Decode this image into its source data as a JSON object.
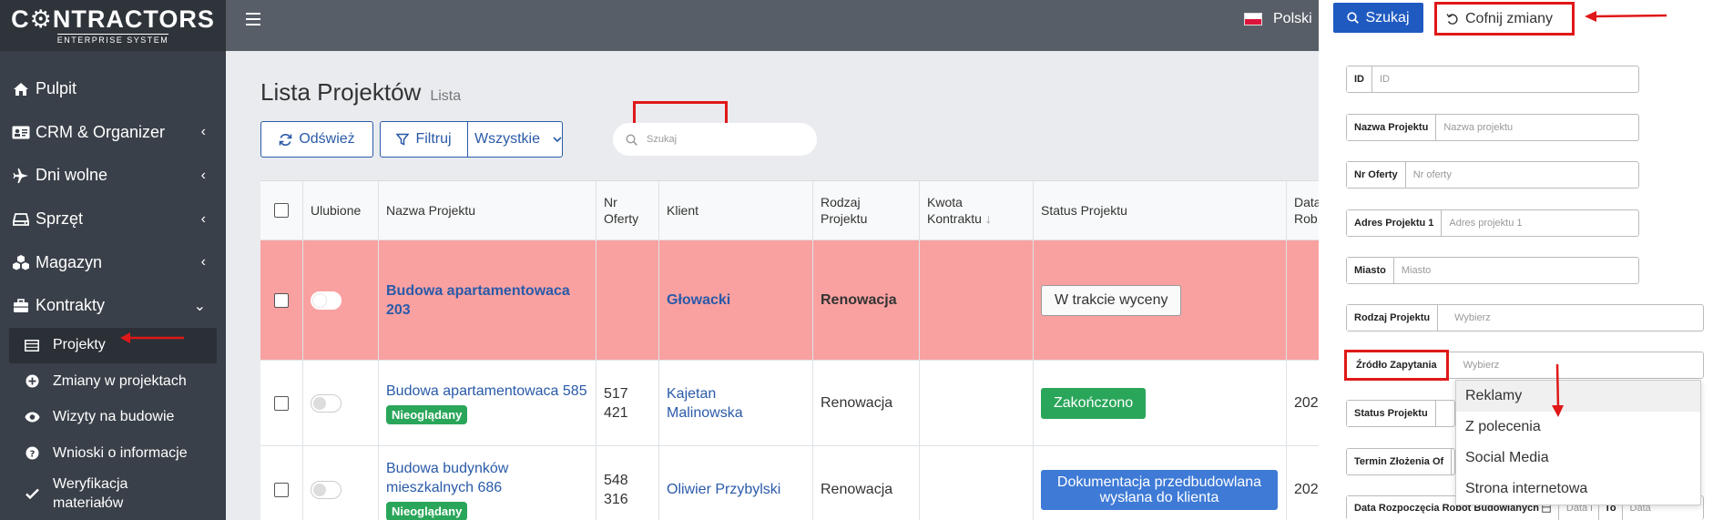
{
  "brand": {
    "name_pre": "C",
    "name_post": "NTRACTORS",
    "tagline": "ENTERPRISE SYSTEM"
  },
  "sidebar": {
    "items": [
      {
        "label": "Pulpit",
        "icon": "home-icon"
      },
      {
        "label": "CRM & Organizer",
        "icon": "id-card-icon"
      },
      {
        "label": "Dni wolne",
        "icon": "plane-icon"
      },
      {
        "label": "Sprzęt",
        "icon": "hdd-icon"
      },
      {
        "label": "Magazyn",
        "icon": "cubes-icon"
      },
      {
        "label": "Kontrakty",
        "icon": "briefcase-icon"
      }
    ],
    "sub_items": [
      {
        "label": "Projekty",
        "icon": "table-icon"
      },
      {
        "label": "Zmiany w projektach",
        "icon": "plus-circle-icon"
      },
      {
        "label": "Wizyty na budowie",
        "icon": "eye-icon"
      },
      {
        "label": "Wnioski o informacje",
        "icon": "question-circle-icon"
      },
      {
        "label": "Weryfikacja materiałów",
        "icon": "check-icon"
      }
    ]
  },
  "topbar": {
    "language": "Polski"
  },
  "page": {
    "title": "Lista Projektów",
    "subtitle": "Lista"
  },
  "toolbar": {
    "refresh_label": "Odśwież",
    "filter_label": "Filtruj",
    "filter_select": "Wszystkie",
    "search_placeholder": "Szukaj"
  },
  "table": {
    "headers": {
      "favorite": "Ulubione",
      "name": "Nazwa Projektu",
      "offer_a": "Nr",
      "offer_b": "Oferty",
      "client": "Klient",
      "type_a": "Rodzaj",
      "type_b": "Projektu",
      "amount_a": "Kwota",
      "amount_b": "Kontraktu",
      "status": "Status Projektu",
      "date_a": "Data",
      "date_b": "Rob"
    },
    "rows": [
      {
        "name": "Budowa apartamentowaca 203",
        "badge": "",
        "offer": "",
        "client": "Głowacki",
        "type": "Renowacja",
        "status": "W trakcie wyceny",
        "date": ""
      },
      {
        "name": "Budowa apartamentowaca 585",
        "badge": "Nieoglądany",
        "offer": "517 421",
        "client": "Kajetan Malinowska",
        "type": "Renowacja",
        "status": "Zakończono",
        "date": "202"
      },
      {
        "name": "Budowa budynków mieszkalnych 686",
        "badge": "Nieoglądany",
        "offer": "548 316",
        "client": "Oliwier Przybylski",
        "type": "Renowacja",
        "status": "Dokumentacja przedbudowlana wysłana do klienta",
        "date": "202"
      }
    ]
  },
  "panel": {
    "search_label": "Szukaj",
    "undo_label": "Cofnij zmiany",
    "fields": [
      {
        "label": "ID",
        "placeholder": "ID"
      },
      {
        "label": "Nazwa Projektu",
        "placeholder": "Nazwa projektu"
      },
      {
        "label": "Nr Oferty",
        "placeholder": "Nr oferty"
      },
      {
        "label": "Adres Projektu 1",
        "placeholder": "Adres projektu 1"
      },
      {
        "label": "Miasto",
        "placeholder": "Miasto"
      },
      {
        "label": "Rodzaj Projektu",
        "placeholder": "Wybierz"
      },
      {
        "label": "Źródło Zapytania",
        "placeholder": "Wybierz"
      },
      {
        "label": "Status Projektu",
        "placeholder": ""
      },
      {
        "label": "Termin Złożenia Of",
        "placeholder": ""
      },
      {
        "label": "Data Rozpoczęcia Robót Budowlanych",
        "placeholder": "Data i",
        "to_label": "To",
        "to_placeholder": "Data"
      }
    ],
    "dropdown_options": [
      "Reklamy",
      "Z polecenia",
      "Social Media",
      "Strona internetowa"
    ]
  },
  "colors": {
    "accent": "#2a5aa8",
    "highlight_red": "#e01818",
    "row_highlight": "#f9a1a1",
    "badge_green": "#2aa65a",
    "status_blue": "#3e7ad6"
  }
}
